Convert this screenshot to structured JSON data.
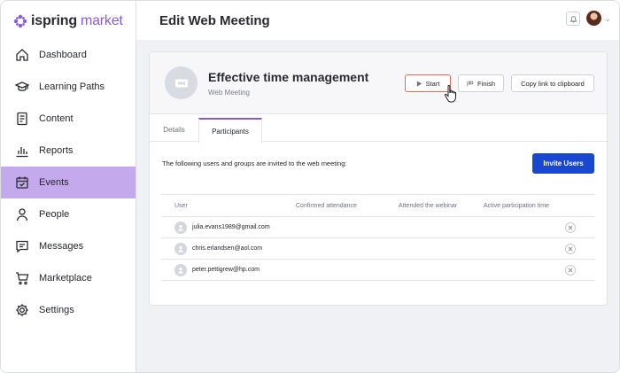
{
  "brand": {
    "logo_word1": "ispring",
    "logo_word2": "market",
    "accent": "#8a5bd8"
  },
  "sidebar": {
    "items": [
      {
        "label": "Dashboard",
        "icon": "home-icon",
        "active": false
      },
      {
        "label": "Learning Paths",
        "icon": "graduation-cap-icon",
        "active": false
      },
      {
        "label": "Content",
        "icon": "document-icon",
        "active": false
      },
      {
        "label": "Reports",
        "icon": "bar-chart-icon",
        "active": false
      },
      {
        "label": "Events",
        "icon": "calendar-check-icon",
        "active": true
      },
      {
        "label": "People",
        "icon": "person-icon",
        "active": false
      },
      {
        "label": "Messages",
        "icon": "chat-icon",
        "active": false
      },
      {
        "label": "Marketplace",
        "icon": "cart-icon",
        "active": false
      },
      {
        "label": "Settings",
        "icon": "gear-icon",
        "active": false
      }
    ],
    "active_color": "#c4a9ed"
  },
  "header": {
    "title": "Edit Web Meeting"
  },
  "meeting": {
    "title": "Effective time management",
    "subtitle": "Web Meeting",
    "start_label": "Start",
    "finish_label": "Finish",
    "copy_label": "Copy link to clipboard"
  },
  "tabs": [
    {
      "label": "Details",
      "active": false
    },
    {
      "label": "Participants",
      "active": true
    }
  ],
  "participants": {
    "intro": "The following users and groups are invited to the web meeting:",
    "invite_label": "Invite Users",
    "invite_color": "#1a47cf",
    "columns": [
      "User",
      "Confirmed attendance",
      "Attended the webinar",
      "Active participation time"
    ],
    "rows": [
      {
        "email": "julia.evans1989@gmail.com"
      },
      {
        "email": "chris.erlandsen@aol.com"
      },
      {
        "email": "peter.pettigrew@hp.com"
      }
    ]
  }
}
